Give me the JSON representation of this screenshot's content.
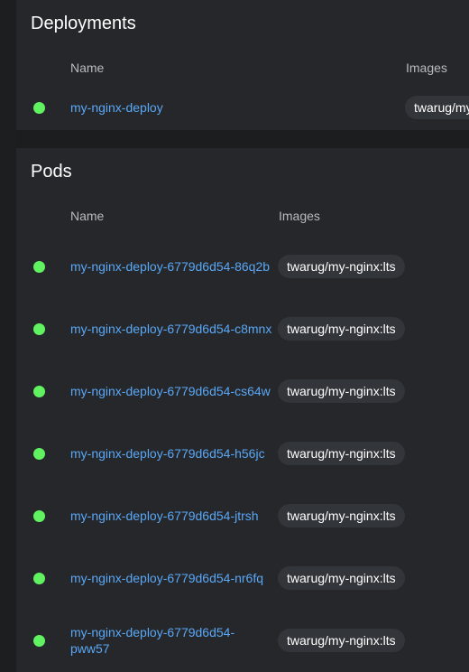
{
  "deployments": {
    "title": "Deployments",
    "columns": {
      "name": "Name",
      "images": "Images"
    },
    "rows": [
      {
        "status": "running",
        "name": "my-nginx-deploy",
        "image": "twarug/my-nginx:lts"
      }
    ]
  },
  "pods": {
    "title": "Pods",
    "columns": {
      "name": "Name",
      "images": "Images"
    },
    "rows": [
      {
        "status": "running",
        "name": "my-nginx-deploy-6779d6d54-86q2b",
        "image": "twarug/my-nginx:lts"
      },
      {
        "status": "running",
        "name": "my-nginx-deploy-6779d6d54-c8mnx",
        "image": "twarug/my-nginx:lts"
      },
      {
        "status": "running",
        "name": "my-nginx-deploy-6779d6d54-cs64w",
        "image": "twarug/my-nginx:lts"
      },
      {
        "status": "running",
        "name": "my-nginx-deploy-6779d6d54-h56jc",
        "image": "twarug/my-nginx:lts"
      },
      {
        "status": "running",
        "name": "my-nginx-deploy-6779d6d54-jtrsh",
        "image": "twarug/my-nginx:lts"
      },
      {
        "status": "running",
        "name": "my-nginx-deploy-6779d6d54-nr6fq",
        "image": "twarug/my-nginx:lts"
      },
      {
        "status": "running",
        "name": "my-nginx-deploy-6779d6d54-pww57",
        "image": "twarug/my-nginx:lts"
      }
    ]
  },
  "colors": {
    "background": "#1b1d1f",
    "card": "#25272a",
    "status_running": "#61f261",
    "link": "#5aa7f5",
    "chip": "#323539",
    "header_text": "#b8babd"
  }
}
